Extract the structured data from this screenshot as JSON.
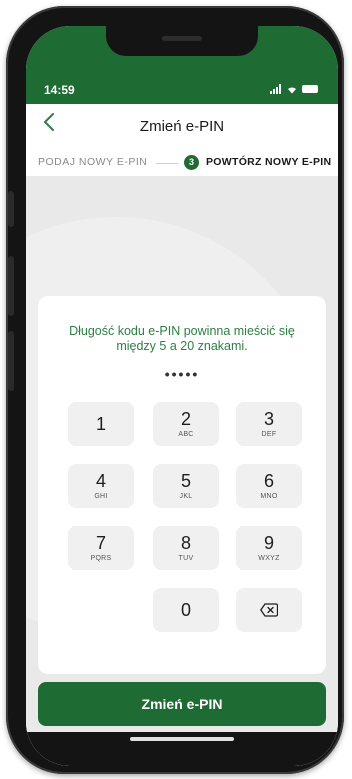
{
  "status_bar": {
    "time": "14:59"
  },
  "header": {
    "back_icon": "chevron-left-icon",
    "title": "Zmień e-PIN"
  },
  "steps": {
    "step1_label": "PODAJ NOWY E-PIN",
    "step2_number": "3",
    "step2_label": "POWTÓRZ NOWY E-PIN"
  },
  "pin_card": {
    "message": "Długość kodu e-PIN powinna mieścić się między 5 a 20 znakami.",
    "pin_mask": "•••••"
  },
  "keypad": {
    "keys": [
      {
        "digit": "1",
        "letters": ""
      },
      {
        "digit": "2",
        "letters": "ABC"
      },
      {
        "digit": "3",
        "letters": "DEF"
      },
      {
        "digit": "4",
        "letters": "GHI"
      },
      {
        "digit": "5",
        "letters": "JKL"
      },
      {
        "digit": "6",
        "letters": "MNO"
      },
      {
        "digit": "7",
        "letters": "PQRS"
      },
      {
        "digit": "8",
        "letters": "TUV"
      },
      {
        "digit": "9",
        "letters": "WXYZ"
      },
      {
        "digit": "0",
        "letters": ""
      }
    ],
    "delete_icon": "backspace-icon"
  },
  "primary_button": {
    "label": "Zmień e-PIN"
  },
  "colors": {
    "brand_green": "#1e6b34",
    "accent_green": "#2f7d45"
  }
}
